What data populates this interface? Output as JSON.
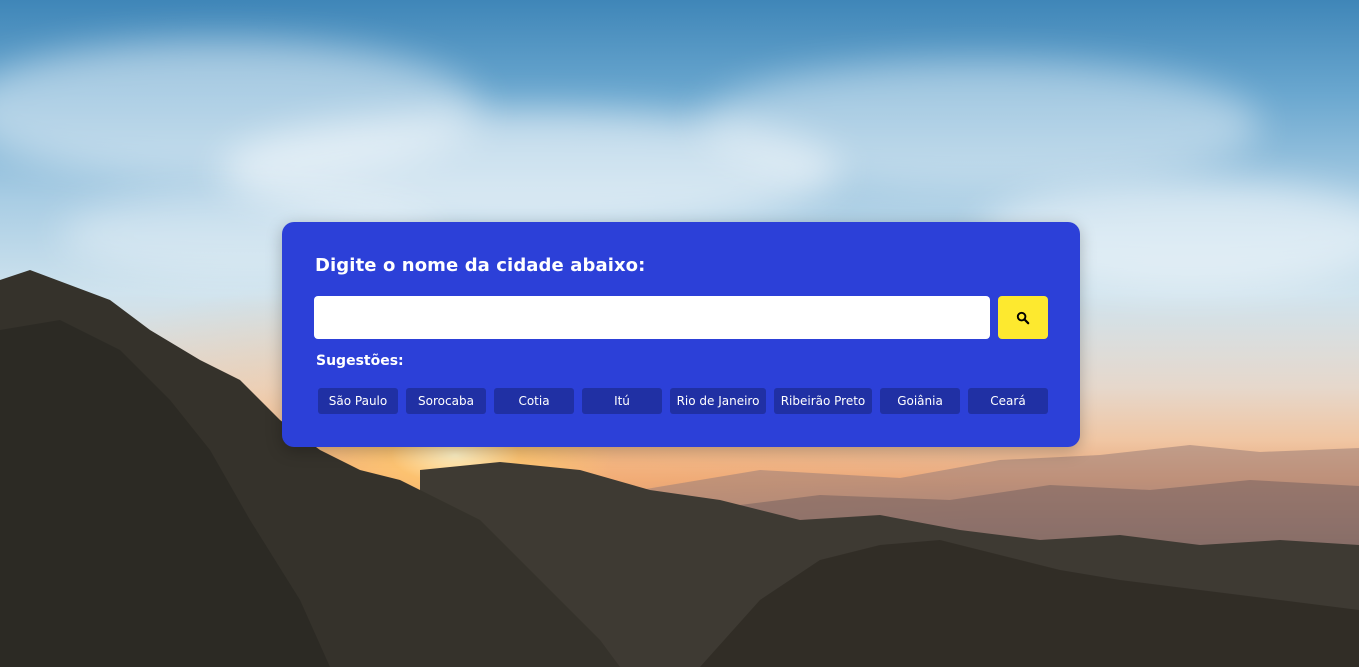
{
  "background": {
    "description_icon": "sunset-mountains-background"
  },
  "panel": {
    "title": "Digite o nome da cidade abaixo:",
    "accent_color": "#2c40d8",
    "search": {
      "value": "",
      "placeholder": "",
      "button_icon": "search-icon",
      "button_color": "#fde92f"
    },
    "suggestions_label": "Sugestões:",
    "suggestions": [
      "São Paulo",
      "Sorocaba",
      "Cotia",
      "Itú",
      "Rio de Janeiro",
      "Ribeirão Preto",
      "Goiânia",
      "Ceará"
    ]
  }
}
